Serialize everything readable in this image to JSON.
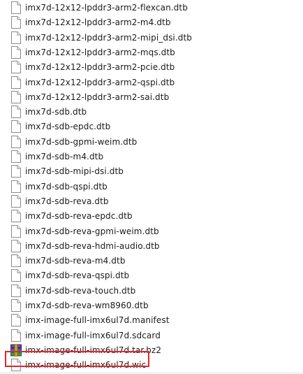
{
  "files": [
    {
      "name": "imx7d-12x12-lpddr3-arm2-flexcan.dtb",
      "icon": "file-icon"
    },
    {
      "name": "imx7d-12x12-lpddr3-arm2-m4.dtb",
      "icon": "file-icon"
    },
    {
      "name": "imx7d-12x12-lpddr3-arm2-mipi_dsi.dtb",
      "icon": "file-icon"
    },
    {
      "name": "imx7d-12x12-lpddr3-arm2-mqs.dtb",
      "icon": "file-icon"
    },
    {
      "name": "imx7d-12x12-lpddr3-arm2-pcie.dtb",
      "icon": "file-icon"
    },
    {
      "name": "imx7d-12x12-lpddr3-arm2-qspi.dtb",
      "icon": "file-icon"
    },
    {
      "name": "imx7d-12x12-lpddr3-arm2-sai.dtb",
      "icon": "file-icon"
    },
    {
      "name": "imx7d-sdb.dtb",
      "icon": "file-icon"
    },
    {
      "name": "imx7d-sdb-epdc.dtb",
      "icon": "file-icon"
    },
    {
      "name": "imx7d-sdb-gpmi-weim.dtb",
      "icon": "file-icon"
    },
    {
      "name": "imx7d-sdb-m4.dtb",
      "icon": "file-icon"
    },
    {
      "name": "imx7d-sdb-mipi-dsi.dtb",
      "icon": "file-icon"
    },
    {
      "name": "imx7d-sdb-qspi.dtb",
      "icon": "file-icon"
    },
    {
      "name": "imx7d-sdb-reva.dtb",
      "icon": "file-icon"
    },
    {
      "name": "imx7d-sdb-reva-epdc.dtb",
      "icon": "file-icon"
    },
    {
      "name": "imx7d-sdb-reva-gpmi-weim.dtb",
      "icon": "file-icon"
    },
    {
      "name": "imx7d-sdb-reva-hdmi-audio.dtb",
      "icon": "file-icon"
    },
    {
      "name": "imx7d-sdb-reva-m4.dtb",
      "icon": "file-icon"
    },
    {
      "name": "imx7d-sdb-reva-qspi.dtb",
      "icon": "file-icon"
    },
    {
      "name": "imx7d-sdb-reva-touch.dtb",
      "icon": "file-icon"
    },
    {
      "name": "imx7d-sdb-reva-wm8960.dtb",
      "icon": "file-icon"
    },
    {
      "name": "imx-image-full-imx6ul7d.manifest",
      "icon": "file-icon"
    },
    {
      "name": "imx-image-full-imx6ul7d.sdcard",
      "icon": "file-icon"
    },
    {
      "name": "imx-image-full-imx6ul7d.tar.bz2",
      "icon": "archive-icon"
    },
    {
      "name": "imx-image-full-imx6ul7d.wic",
      "icon": "file-icon",
      "highlighted": true
    }
  ],
  "colors": {
    "highlight_border": "#e0262c",
    "text": "#1a1a1a"
  }
}
